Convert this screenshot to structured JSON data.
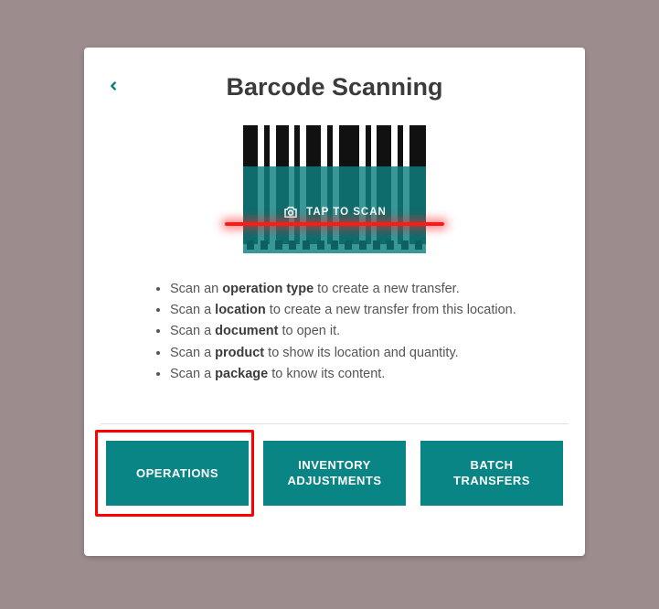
{
  "header": {
    "title": "Barcode Scanning"
  },
  "scan": {
    "prompt": "TAP TO SCAN"
  },
  "instructions": [
    {
      "prefix": "Scan an ",
      "bold": "operation type",
      "suffix": " to create a new transfer."
    },
    {
      "prefix": "Scan a ",
      "bold": "location",
      "suffix": " to create a new transfer from this location."
    },
    {
      "prefix": "Scan a ",
      "bold": "document",
      "suffix": " to open it."
    },
    {
      "prefix": "Scan a ",
      "bold": "product",
      "suffix": " to show its location and quantity."
    },
    {
      "prefix": "Scan a ",
      "bold": "package",
      "suffix": " to know its content."
    }
  ],
  "buttons": {
    "operations": "OPERATIONS",
    "inventory": "INVENTORY\nADJUSTMENTS",
    "batch": "BATCH\nTRANSFERS"
  }
}
